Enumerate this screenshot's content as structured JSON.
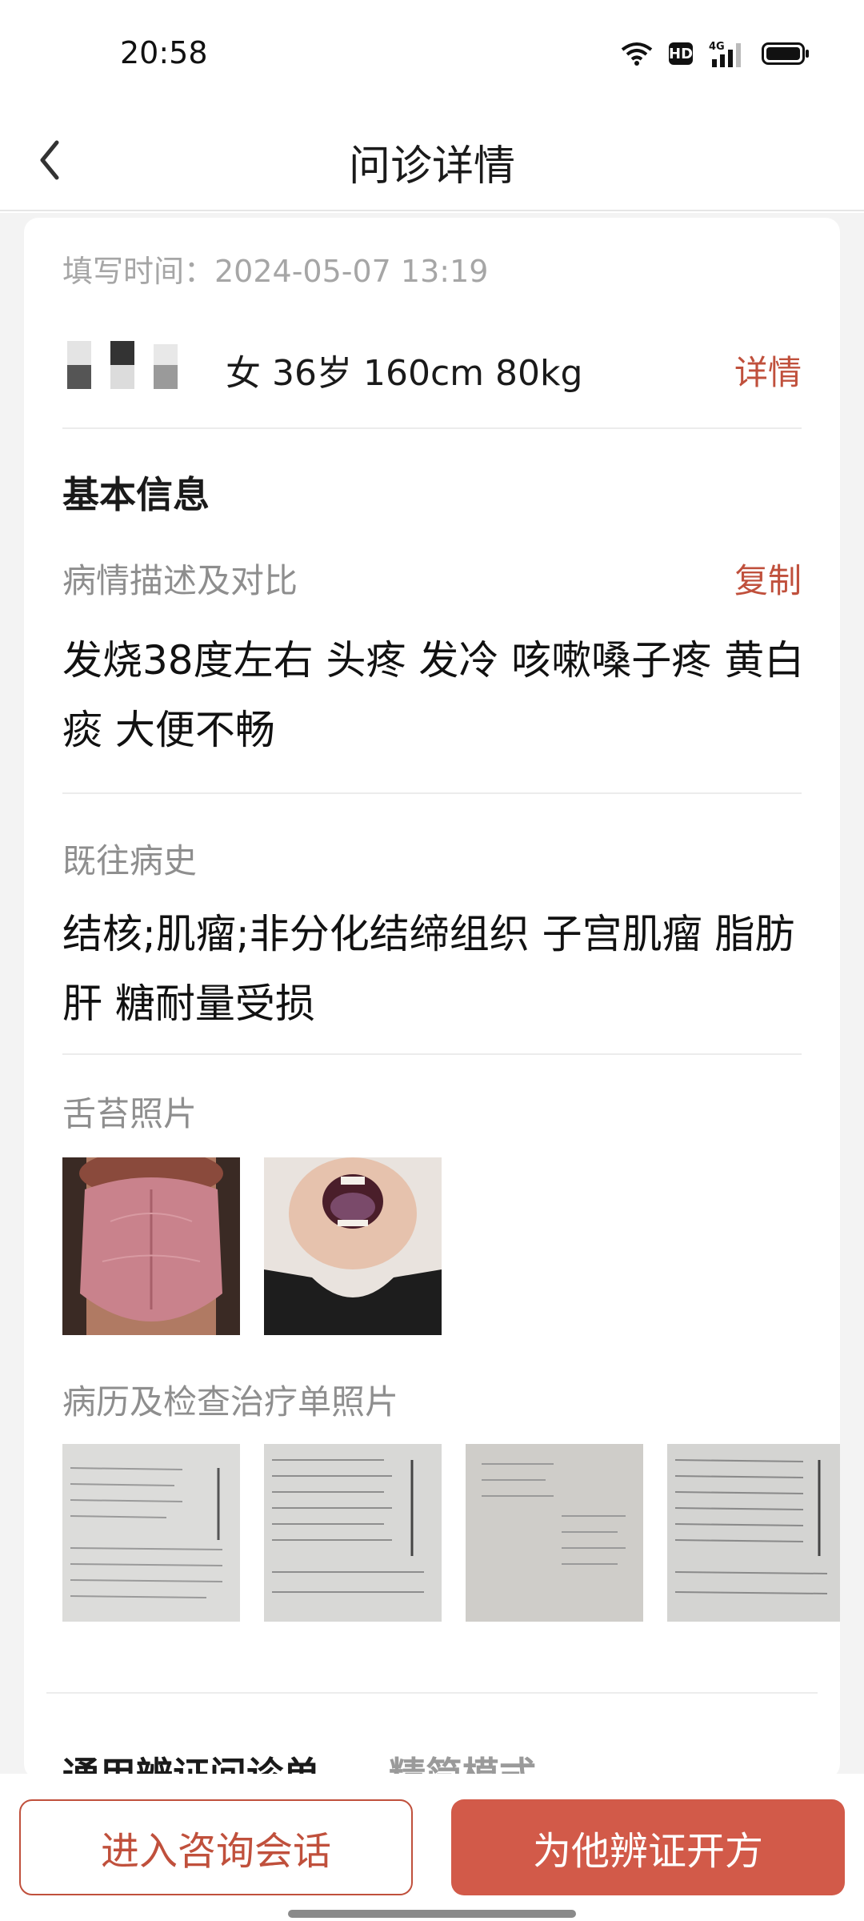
{
  "status_bar": {
    "time": "20:58",
    "hd_label": "HD",
    "network_label": "4G",
    "icons": [
      "wifi-icon",
      "hd-icon",
      "signal-icon",
      "battery-icon"
    ]
  },
  "nav": {
    "title": "问诊详情",
    "back_icon": "chevron-left-icon"
  },
  "card": {
    "fill_time": "填写时间：2024-05-07 13:19",
    "patient_info": "女 36岁 160cm 80kg",
    "detail_link": "详情",
    "section_title": "基本信息",
    "condition_label": "病情描述及对比",
    "copy_label": "复制",
    "condition_text": "发烧38度左右 头疼 发冷 咳嗽嗓子疼 黄白痰 大便不畅",
    "history_label": "既往病史",
    "history_text": "结核;肌瘤;非分化结缔组织 子宫肌瘤 脂肪肝 糖耐量受损",
    "tongue_label": "舌苔照片",
    "tongue_photos": [
      "tongue-photo-1",
      "tongue-photo-2"
    ],
    "records_label": "病历及检查治疗单照片",
    "record_photos": [
      "record-photo-1",
      "record-photo-2",
      "record-photo-3",
      "record-photo-4"
    ],
    "bottom_tab_1": "通用辨证问诊单",
    "bottom_tab_2": "精简模式"
  },
  "actions": {
    "enter_chat": "进入咨询会话",
    "prescribe": "为他辨证开方"
  },
  "colors": {
    "accent": "#c0503c",
    "primary_button": "#d25a49",
    "label_gray": "#8e8e8e",
    "background": "#f3f3f3"
  }
}
